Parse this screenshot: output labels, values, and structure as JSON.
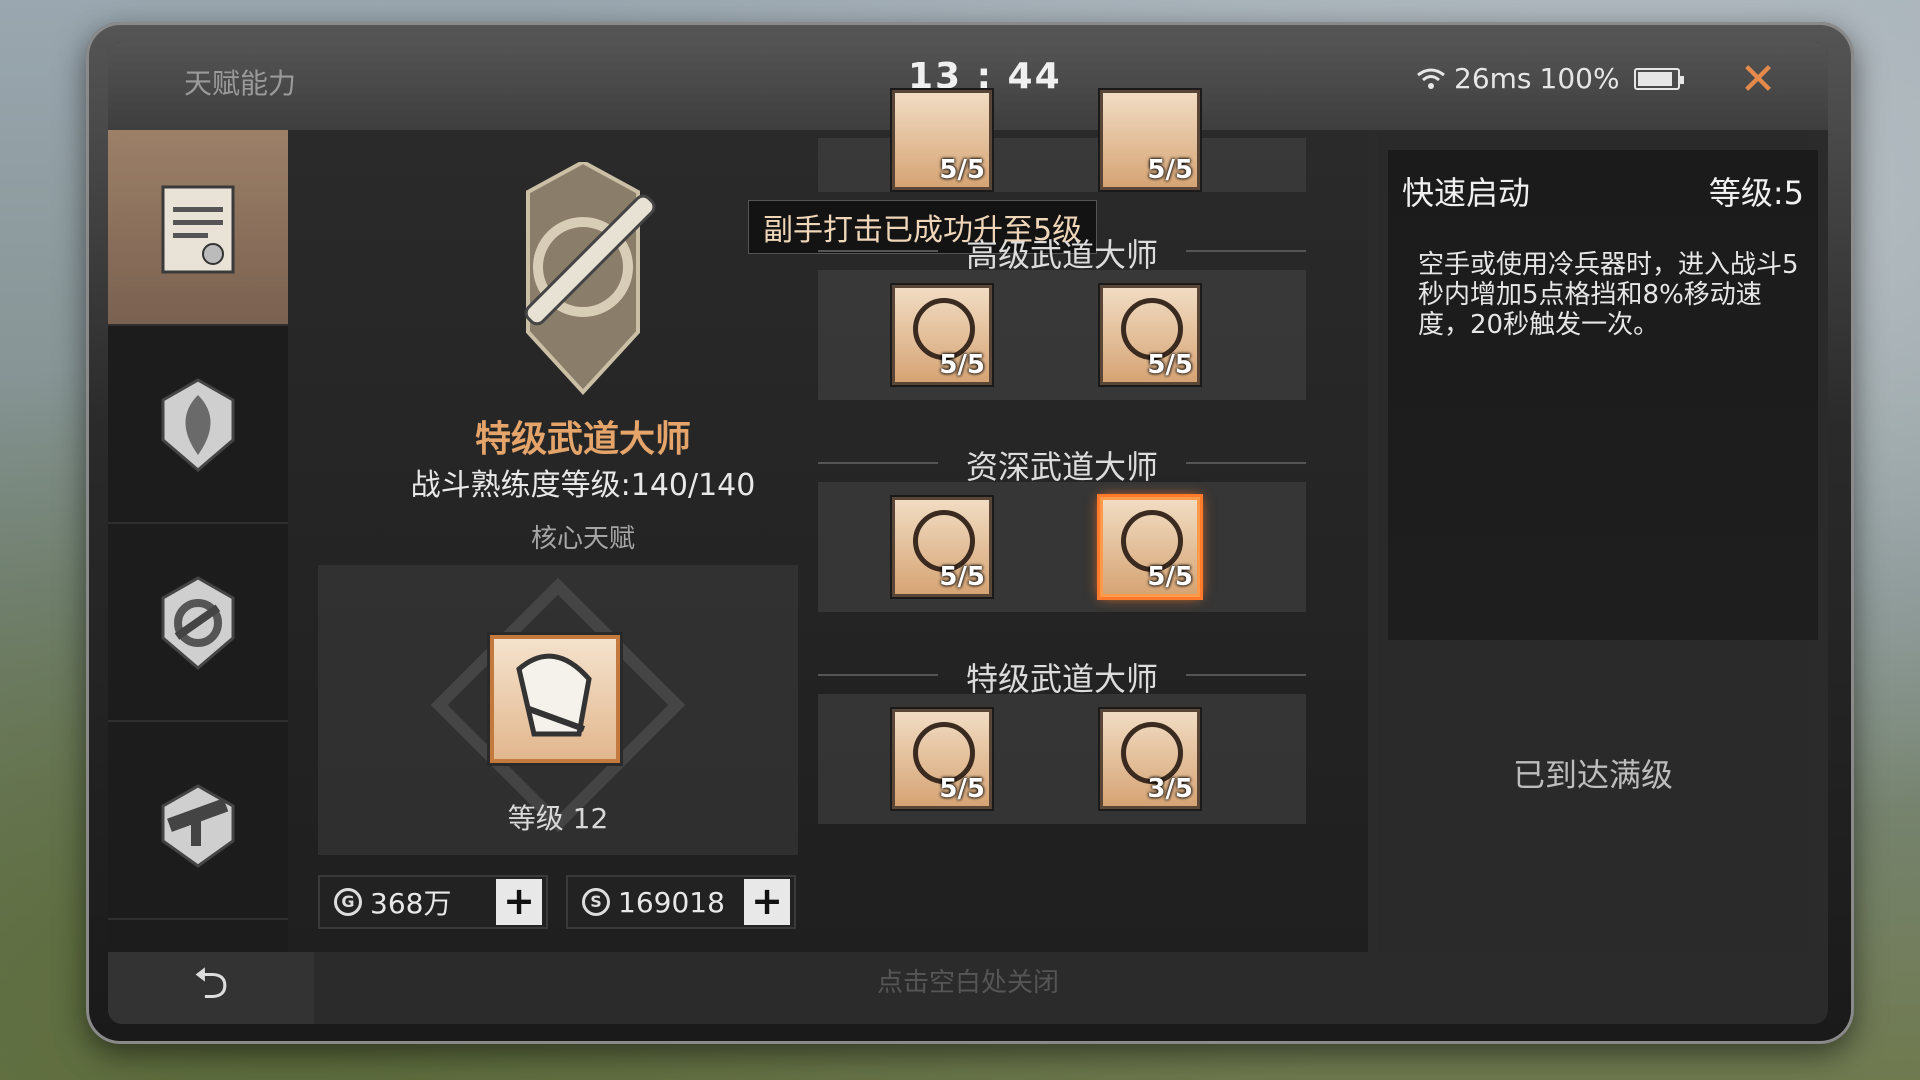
{
  "header": {
    "panel_title": "天赋能力",
    "clock": "13 : 44",
    "ping": "26ms",
    "battery": "100%"
  },
  "sidebar": {
    "items": [
      {
        "name": "trade-certificate-icon",
        "active": true
      },
      {
        "name": "leaf-badge-icon",
        "active": false
      },
      {
        "name": "gear-hammer-badge-icon",
        "active": false
      },
      {
        "name": "smg-badge-icon",
        "active": false
      }
    ]
  },
  "talent": {
    "name": "特级武道大师",
    "mastery": "战斗熟练度等级:140/140",
    "core_label": "核心天赋",
    "core_level": "等级 12"
  },
  "currency": {
    "gold": "368万",
    "silver": "169018"
  },
  "toast": "副手打击已成功升至5级",
  "tree": {
    "tiers": [
      {
        "title": "高级武道大师",
        "skills": [
          {
            "level": "5/5"
          },
          {
            "level": "5/5"
          }
        ]
      },
      {
        "title": "资深武道大师",
        "skills": [
          {
            "level": "5/5"
          },
          {
            "level": "5/5"
          }
        ]
      },
      {
        "title": "特级武道大师",
        "skills": [
          {
            "level": "5/5"
          },
          {
            "level": "3/5"
          }
        ]
      }
    ],
    "top_partial": [
      {
        "level": "5/5"
      },
      {
        "level": "5/5"
      }
    ]
  },
  "detail": {
    "name": "快速启动",
    "level": "等级:5",
    "desc": "空手或使用冷兵器时，进入战斗5秒内增加5点格挡和8%移动速度，20秒触发一次。",
    "maxed": "已到达满级"
  },
  "hint": "点击空白处关闭",
  "colors": {
    "accent": "#e4a46a",
    "highlight": "#ff7a2a"
  }
}
